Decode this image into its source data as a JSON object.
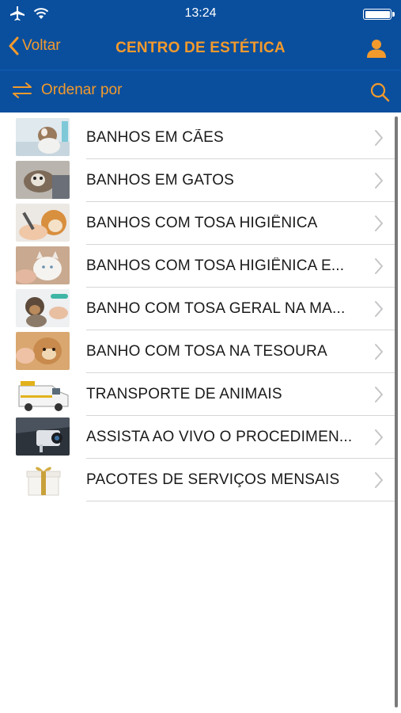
{
  "status": {
    "time": "13:24"
  },
  "nav": {
    "back_label": "Voltar",
    "title": "CENTRO DE ESTÉTICA"
  },
  "sort": {
    "label": "Ordenar por"
  },
  "colors": {
    "bar": "#0a4f9e",
    "accent": "#f39a2c"
  },
  "items": [
    {
      "label": "BANHOS EM CÃES",
      "thumb": "dog-bath-photo"
    },
    {
      "label": "BANHOS EM GATOS",
      "thumb": "cat-bath-photo"
    },
    {
      "label": "BANHOS COM TOSA HIGIÊNICA",
      "thumb": "dog-grooming-photo"
    },
    {
      "label": "BANHOS COM TOSA HIGIÊNICA E...",
      "thumb": "white-cat-photo"
    },
    {
      "label": "BANHO COM TOSA GERAL NA MA...",
      "thumb": "yorkie-grooming-photo"
    },
    {
      "label": "BANHO COM TOSA NA TESOURA",
      "thumb": "scissor-grooming-photo"
    },
    {
      "label": "TRANSPORTE DE ANIMAIS",
      "thumb": "pet-transport-van-photo"
    },
    {
      "label": "ASSISTA AO VIVO O PROCEDIMEN...",
      "thumb": "security-camera-photo"
    },
    {
      "label": "PACOTES DE SERVIÇOS MENSAIS",
      "thumb": "gift-box-photo"
    }
  ]
}
